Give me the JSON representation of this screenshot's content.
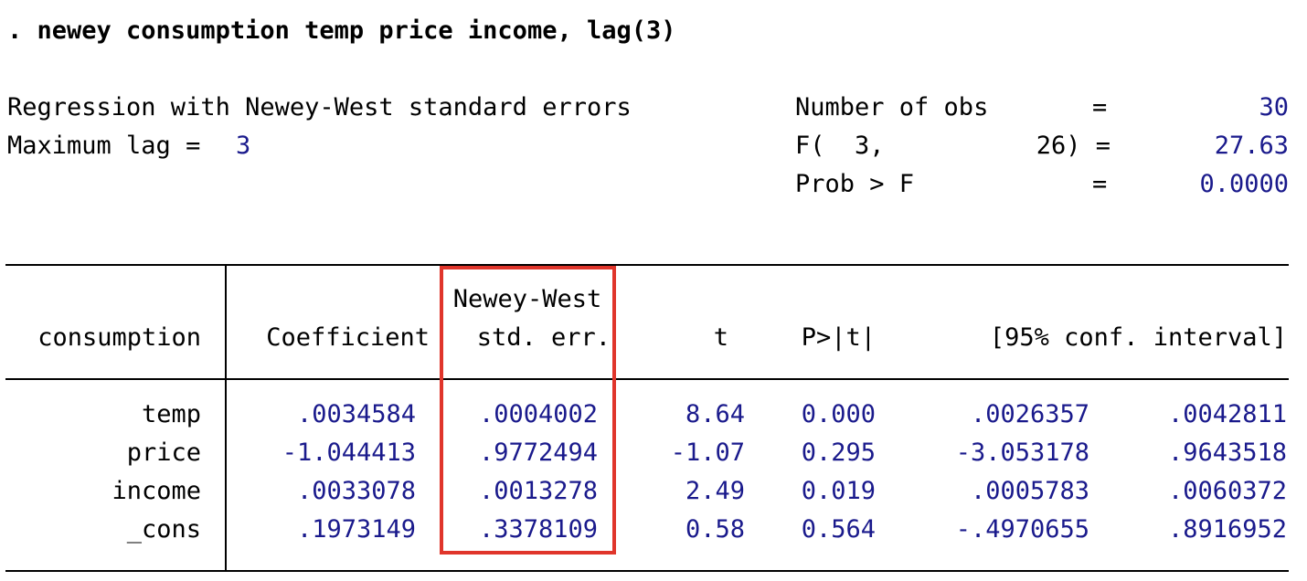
{
  "command": ". newey consumption temp price income, lag(3)",
  "header": {
    "title": "Regression with Newey-West standard errors",
    "maxlag_label": "Maximum lag =",
    "maxlag_value": "3",
    "stats": [
      {
        "label": "Number of obs",
        "eq": "=",
        "value": "30"
      },
      {
        "label": "F(  3,",
        "label2": "26) =",
        "value": "27.63"
      },
      {
        "label": "Prob > F",
        "eq": "=",
        "value": "0.0000"
      }
    ]
  },
  "table": {
    "depvar": "consumption",
    "columns": {
      "coef": "Coefficient",
      "se_top": "Newey-West",
      "se_bottom": "std. err.",
      "t": "t",
      "p": "P>|t|",
      "ci": "[95% conf. interval]"
    },
    "rows": [
      {
        "var": "temp",
        "coef": ".0034584",
        "se": ".0004002",
        "t": "8.64",
        "p": "0.000",
        "lo": ".0026357",
        "hi": ".0042811"
      },
      {
        "var": "price",
        "coef": "-1.044413",
        "se": ".9772494",
        "t": "-1.07",
        "p": "0.295",
        "lo": "-3.053178",
        "hi": ".9643518"
      },
      {
        "var": "income",
        "coef": ".0033078",
        "se": ".0013278",
        "t": "2.49",
        "p": "0.019",
        "lo": ".0005783",
        "hi": ".0060372"
      },
      {
        "var": "_cons",
        "coef": ".1973149",
        "se": ".3378109",
        "t": "0.58",
        "p": "0.564",
        "lo": "-.4970655",
        "hi": ".8916952"
      }
    ]
  },
  "colors": {
    "numbers": "#1a1a8c",
    "highlight": "#e0352b"
  }
}
